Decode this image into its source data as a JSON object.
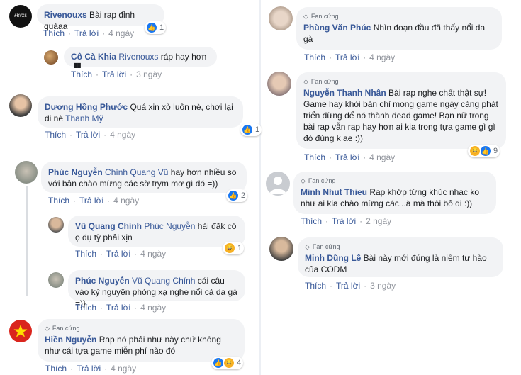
{
  "common": {
    "like": "Thích",
    "reply": "Trả lời",
    "dot": "·",
    "fan_badge": "Fan cứng",
    "diamond_icon": "diamond-icon",
    "like_icon": "like-icon",
    "haha_icon": "haha-icon"
  },
  "left": [
    {
      "author": "Rivenouxs",
      "mention": "",
      "text": "Bài rap đỉnh quáaa",
      "time": "4 ngày",
      "reactions": "1",
      "avatar_text": "#RVXS"
    },
    {
      "author": "Cô Cà Khia",
      "mention": "Rivenouxs",
      "text": "ráp hay hơn ▝▘",
      "time": "3 ngày",
      "reactions": ""
    },
    {
      "author": "Dương Hồng Phước",
      "mention": "",
      "text": "Quá xịn xò luôn nè, chơi lại đi nè",
      "mention2": "Thanh Mỹ",
      "time": "4 ngày",
      "reactions": "1"
    },
    {
      "author": "Phúc Nguyễn",
      "mention": "Chính Quang Vũ",
      "text": "hay hơn nhiều so với bản chào mừng các sờ trym mơ gì đó =))",
      "time": "4 ngày",
      "reactions": "2"
    },
    {
      "author": "Vũ Quang Chính",
      "mention": "Phúc Nguyễn",
      "text": "hải đăk cô ọ đụ tỳ phải xịn",
      "time": "4 ngày",
      "reactions": "1"
    },
    {
      "author": "Phúc Nguyễn",
      "mention": "Vũ Quang Chính",
      "text": "cái câu vào kỷ nguyên phóng xạ nghe nổi cả da gà =)}",
      "time": "4 ngày",
      "reactions": ""
    },
    {
      "author": "Hiền Nguyễn",
      "mention": "",
      "text": "Rap nó phải như này chứ không như cái tựa game miễn phí nào đó",
      "time": "4 ngày",
      "reactions": "4"
    }
  ],
  "right": [
    {
      "author": "Phùng Văn Phúc",
      "text": "Nhìn đoạn đầu đã thấy nổi da gà",
      "time": "4 ngày",
      "reactions": ""
    },
    {
      "author": "Nguyễn Thanh Nhân",
      "text": "Bài rap nghe chất thật sự! Game hay khỏi bàn chỉ mong game ngày càng phát triển đừng để nó thành dead game! Bạn nữ trong bài rap vẫn rap hay hơn ai kia trong tựa game gì gì đó đúng k ae :))",
      "time": "4 ngày",
      "reactions": "9"
    },
    {
      "author": "Minh Nhut Thieu",
      "text": "Rap khớp từng khúc nhạc ko như ai kia chào mừng các...à mà thôi bỏ đi :))",
      "time": "2 ngày",
      "reactions": ""
    },
    {
      "author": "Minh Dũng Lê",
      "text": "Bài này mới đúng là niềm tự hào của CODM",
      "time": "3 ngày",
      "reactions": ""
    }
  ]
}
